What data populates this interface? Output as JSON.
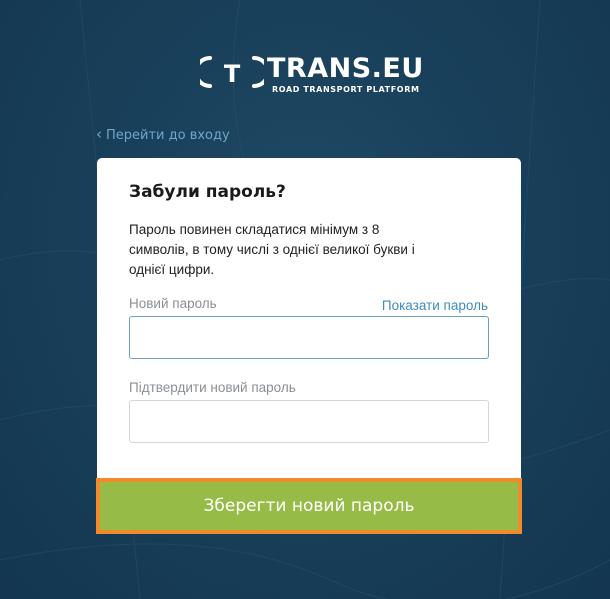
{
  "header": {
    "logo_text": "TRANS.EU",
    "logo_tagline": "ROAD TRANSPORT PLATFORM",
    "logo_mark": "T"
  },
  "nav": {
    "back_label": "Перейти до входу",
    "back_icon": "chevron-left-icon"
  },
  "form": {
    "title": "Забули пароль?",
    "description": "Пароль повинен складатися мінімум з 8 символів, в тому числі з однієї великої букви і однієї цифри.",
    "new_password": {
      "label": "Новий пароль",
      "value": "",
      "show_label": "Показати пароль"
    },
    "confirm_password": {
      "label": "Підтвердити новий пароль",
      "value": ""
    },
    "submit_label": "Зберегти новий пароль"
  },
  "colors": {
    "background": "#19405a",
    "link": "#3d8cbf",
    "submit": "#96bc47",
    "highlight_border": "#f08a2a"
  }
}
